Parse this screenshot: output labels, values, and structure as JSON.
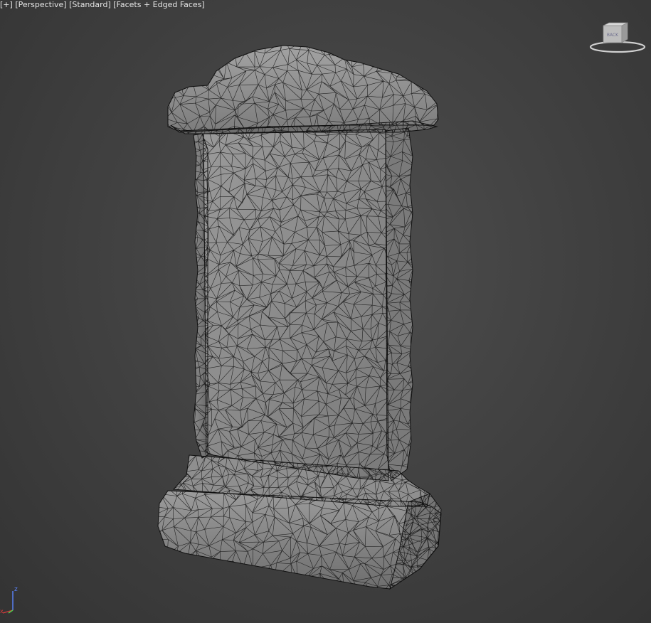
{
  "viewport": {
    "label_parts": [
      "[+]",
      "[Perspective]",
      "[Standard]",
      "[Facets + Edged Faces]"
    ],
    "view": "Perspective",
    "shading": "Standard",
    "display_mode": "Facets + Edged Faces",
    "background_color": "#454545"
  },
  "viewcube": {
    "face_label": "BACK",
    "icon": "viewcube-icon"
  },
  "axis_tripod": {
    "z_label": "z",
    "x_label": "x",
    "icon": "axis-tripod-icon",
    "z_color": "#5b84ff",
    "x_color": "#d33c3c",
    "y_color": "#4fce4f"
  },
  "model": {
    "icon": "tombstone-wireframe-mesh",
    "face_color": "#8c8c8c",
    "edge_color": "#101010"
  }
}
